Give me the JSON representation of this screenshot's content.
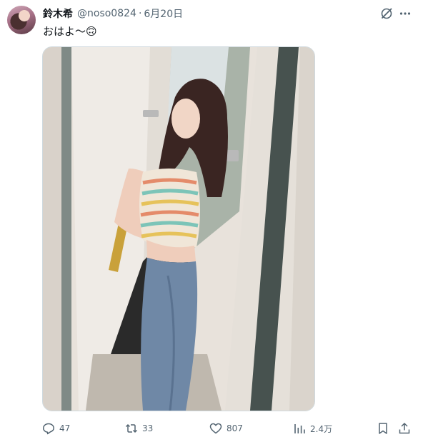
{
  "post": {
    "display_name": "鈴木希",
    "handle": "@noso0824",
    "separator": "·",
    "date": "6月20日",
    "text": "おはよ〜🙃",
    "media_alt": "photo"
  },
  "actions": {
    "replies": "47",
    "reposts": "33",
    "likes": "807",
    "views": "2.4万"
  },
  "colors": {
    "text_primary": "#0f1419",
    "text_secondary": "#536471",
    "border": "#cfd9de"
  },
  "icons": [
    "grok-icon",
    "more-icon",
    "reply-icon",
    "repost-icon",
    "like-icon",
    "views-icon",
    "bookmark-icon",
    "share-icon"
  ]
}
